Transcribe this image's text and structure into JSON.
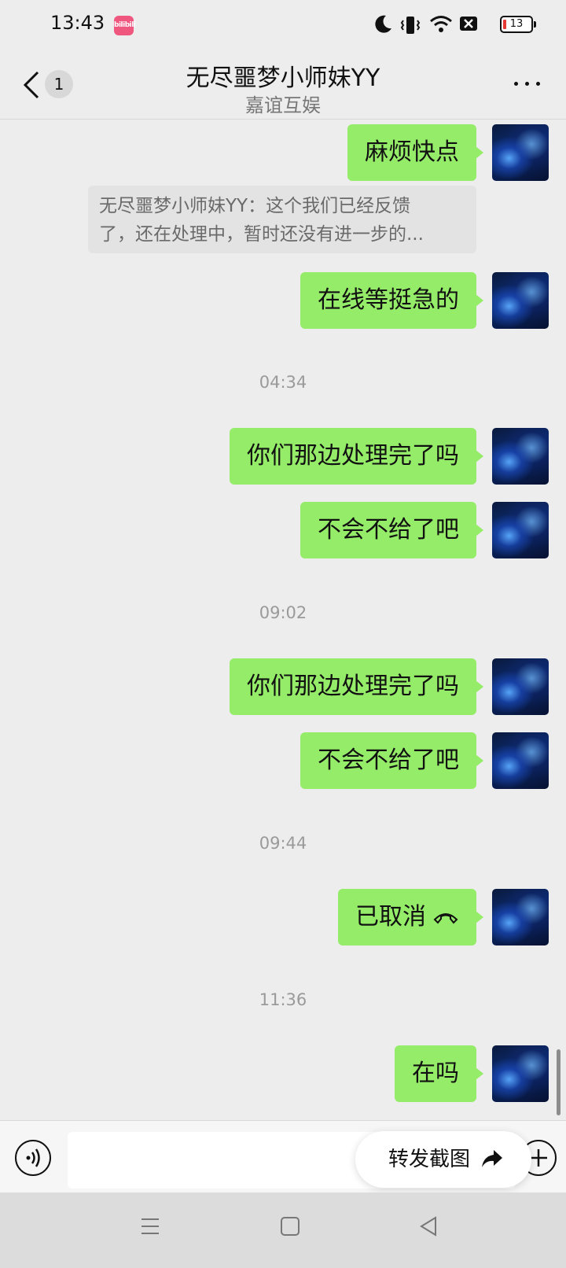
{
  "status_bar": {
    "time": "13:43",
    "app_badge": "bilibili",
    "battery_level": "13",
    "icons": [
      "moon-icon",
      "vibrate-icon",
      "wifi-icon",
      "sim-off-icon",
      "battery-icon"
    ]
  },
  "header": {
    "unread_count": "1",
    "title": "无尽噩梦小师妹YY",
    "subtitle": "嘉谊互娱"
  },
  "quote": {
    "line1": "无尽噩梦小师妹YY：这个我们已经反馈",
    "line2": "了，还在处理中，暂时还没有进一步的..."
  },
  "messages": [
    {
      "text": "麻烦快点"
    },
    {
      "text": "在线等挺急的"
    },
    {
      "text": "你们那边处理完了吗"
    },
    {
      "text": "不会不给了吧"
    },
    {
      "text": "你们那边处理完了吗"
    },
    {
      "text": "不会不给了吧"
    },
    {
      "text": "已取消"
    },
    {
      "text": "在吗"
    }
  ],
  "timestamps": [
    "04:34",
    "09:02",
    "09:44",
    "11:36"
  ],
  "forward_popup": {
    "label": "转发截图"
  },
  "colors": {
    "background": "#ededed",
    "outgoing_bubble": "#95ec69",
    "timestamp_text": "#9a9a9a",
    "battery_low": "#e53935"
  }
}
